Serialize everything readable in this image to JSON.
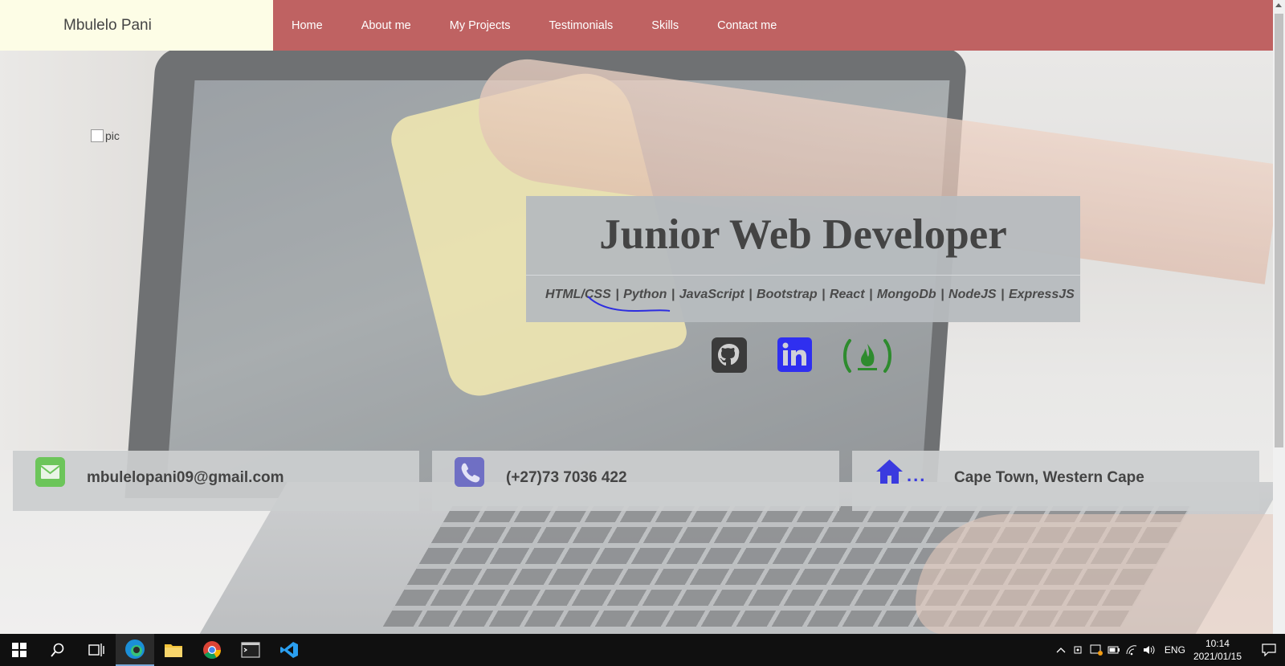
{
  "nav": {
    "brand": "Mbulelo Pani",
    "items": [
      "Home",
      "About me",
      "My Projects",
      "Testimonials",
      "Skills",
      "Contact me"
    ]
  },
  "profile_image": {
    "alt": "pic"
  },
  "hero": {
    "title": "Junior Web Developer",
    "skills": "HTML/CSS | Python | JavaScript | Bootstrap | React | MongoDb | NodeJS | ExpressJS"
  },
  "social": {
    "icons": [
      "github-icon",
      "linkedin-icon",
      "freecodecamp-icon"
    ]
  },
  "contact": {
    "email": "mbulelopani09@gmail.com",
    "phone": "(+27)73 7036 422",
    "location_dots": "...",
    "location": "Cape Town, Western Cape"
  },
  "taskbar": {
    "apps": [
      "windows-start-icon",
      "search-icon",
      "task-view-icon",
      "edge-icon",
      "file-explorer-icon",
      "chrome-icon",
      "terminal-icon",
      "vscode-icon"
    ],
    "language": "ENG",
    "time": "10:14",
    "date": "2021/01/15"
  },
  "colors": {
    "nav_bg": "#bf6262",
    "brand_bg": "#fdfde6",
    "email_icon": "#6cc55a",
    "phone_icon": "#6f6fc4",
    "home_icon": "#3a3adf",
    "linkedin": "#2f2ff0",
    "freecodecamp": "#2e8b2e"
  }
}
